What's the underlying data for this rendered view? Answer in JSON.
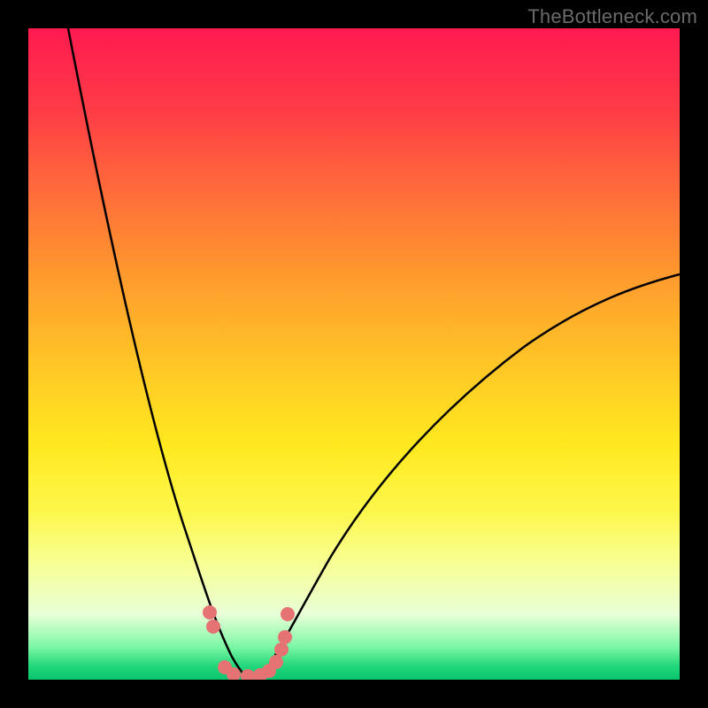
{
  "watermark": "TheBottleneck.com",
  "colors": {
    "frame_bg_top": "#ff1a50",
    "frame_bg_bottom": "#0bc46d",
    "curve_stroke": "#000000",
    "dot_fill": "#e57373",
    "outer_border": "#000000"
  },
  "chart_data": {
    "type": "line",
    "title": "",
    "xlabel": "",
    "ylabel": "",
    "xlim": [
      0,
      100
    ],
    "ylim": [
      0,
      100
    ],
    "series": [
      {
        "name": "left-branch",
        "x": [
          6,
          8,
          10,
          12,
          14,
          16,
          18,
          20,
          22,
          24,
          26,
          27,
          28,
          29,
          30,
          31,
          32,
          33
        ],
        "values": [
          100,
          90,
          78,
          67,
          57,
          48,
          40,
          33,
          27,
          22,
          17,
          14,
          11,
          8.5,
          6,
          4,
          2,
          0
        ]
      },
      {
        "name": "right-branch",
        "x": [
          35,
          37,
          40,
          44,
          48,
          54,
          60,
          68,
          76,
          84,
          92,
          100
        ],
        "values": [
          0,
          3,
          8,
          14,
          20,
          28,
          35,
          43,
          50,
          55,
          59,
          62
        ]
      }
    ],
    "annotations": [
      {
        "name": "dots-near-minimum",
        "x_values": [
          27,
          27.5,
          29,
          30,
          33,
          34.5,
          35,
          35.5,
          36,
          36.5
        ],
        "y_values": [
          10,
          8,
          1,
          0.5,
          0.5,
          0.5,
          1,
          2,
          4,
          8
        ]
      }
    ]
  }
}
